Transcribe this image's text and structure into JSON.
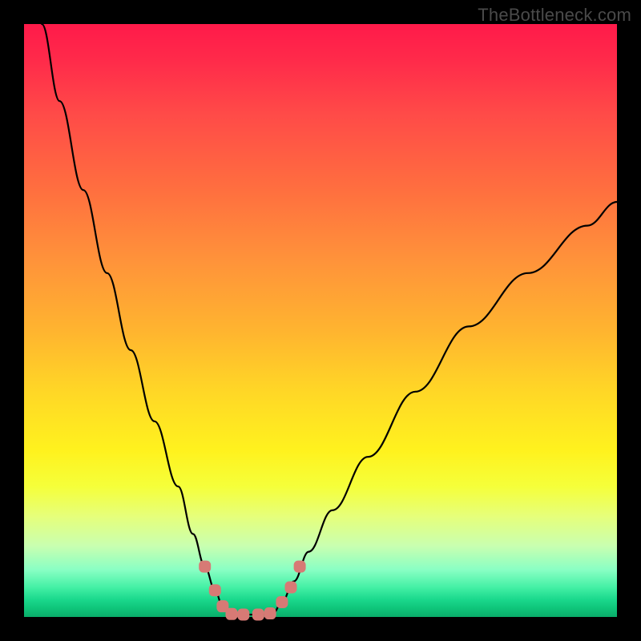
{
  "watermark": "TheBottleneck.com",
  "chart_data": {
    "type": "line",
    "title": "",
    "xlabel": "",
    "ylabel": "",
    "xlim": [
      0,
      1
    ],
    "ylim": [
      0,
      1
    ],
    "grid": false,
    "legend": false,
    "series": [
      {
        "name": "left-curve",
        "x": [
          0.03,
          0.06,
          0.1,
          0.14,
          0.18,
          0.22,
          0.26,
          0.285,
          0.305,
          0.322,
          0.335,
          0.345
        ],
        "y": [
          1.0,
          0.87,
          0.72,
          0.58,
          0.45,
          0.33,
          0.22,
          0.14,
          0.085,
          0.045,
          0.018,
          0.006
        ]
      },
      {
        "name": "flat-floor",
        "x": [
          0.345,
          0.37,
          0.4,
          0.42
        ],
        "y": [
          0.006,
          0.004,
          0.004,
          0.006
        ]
      },
      {
        "name": "right-curve",
        "x": [
          0.42,
          0.435,
          0.455,
          0.48,
          0.52,
          0.58,
          0.66,
          0.75,
          0.85,
          0.95,
          1.0
        ],
        "y": [
          0.006,
          0.025,
          0.06,
          0.11,
          0.18,
          0.27,
          0.38,
          0.49,
          0.58,
          0.66,
          0.7
        ]
      }
    ],
    "markers": [
      {
        "series": "left-curve",
        "x": 0.305,
        "y": 0.085
      },
      {
        "series": "left-curve",
        "x": 0.322,
        "y": 0.045
      },
      {
        "series": "left-curve",
        "x": 0.335,
        "y": 0.018
      },
      {
        "series": "flat-floor",
        "x": 0.35,
        "y": 0.005
      },
      {
        "series": "flat-floor",
        "x": 0.37,
        "y": 0.004
      },
      {
        "series": "flat-floor",
        "x": 0.395,
        "y": 0.004
      },
      {
        "series": "flat-floor",
        "x": 0.415,
        "y": 0.006
      },
      {
        "series": "right-curve",
        "x": 0.435,
        "y": 0.025
      },
      {
        "series": "right-curve",
        "x": 0.45,
        "y": 0.05
      },
      {
        "series": "right-curve",
        "x": 0.465,
        "y": 0.085
      }
    ],
    "gradient_stops": [
      {
        "pos": 0.0,
        "color": "#ff1a4a"
      },
      {
        "pos": 0.5,
        "color": "#ffd726"
      },
      {
        "pos": 0.8,
        "color": "#f5ff3a"
      },
      {
        "pos": 1.0,
        "color": "#0aad6a"
      }
    ]
  }
}
